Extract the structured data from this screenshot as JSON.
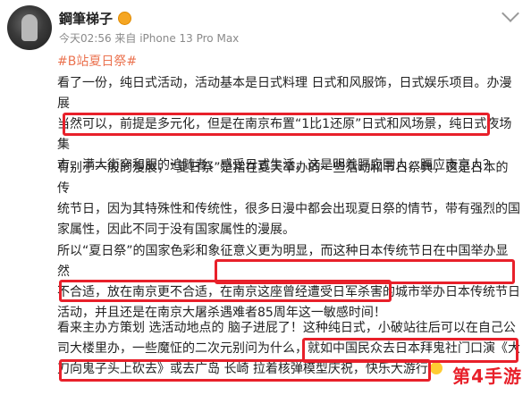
{
  "post": {
    "author": "鋼筆梯子",
    "meta": "今天02:56  来自 iPhone 13 Pro Max",
    "hashtag": "#B站夏日祭#",
    "paragraphs": [
      "看了一份，纯日式活动，活动基本是日式料理 日式和风服饰，日式娱乐项目。办漫展\n当然可以，前提是多元化，但是在南京布置“1比1还原”日式和风场景，纯日式夜场集\n市，满大街穿和服的追随者，感受日式生活，这是明着膈应国人，膈应南京人？",
      "有别于一般的漫展，“夏日祭”是指在夏天举办的一些活动和节日祭典，这是日本的传\n统节日，因为其特殊性和传统性，很多日漫中都会出现夏日祭的情节，带有强烈的国\n家属性，因此不同于没有国家属性的漫展。",
      "所以“夏日祭”的国家色彩和象征意义更为明显，而这种日本传统节日在中国举办显然\n不合适，放在南京更不合适，在南京这座曾经遭受日军杀害的城市举办日本传统节日\n活动，并且还是在南京大屠杀遇难者85周年这一敏感时间！",
      "看来主办方策划 选活动地点的 脑子进屁了！这种纯日式，小破站往后可以在自己公\n司大楼里办，一些魔怔的二次元别问为什么，就如中国民众去日本拜鬼社门口演《大\n刀向鬼子头上砍去》或去广岛 长崎 拉着核弹模型庆祝，快乐大游行"
    ]
  },
  "watermark": "第4手游",
  "icons": [
    "avatar",
    "verified-badge-icon",
    "chevron-down-icon",
    "emoji-icon"
  ],
  "colors": {
    "highlight_box": "#e8202a",
    "hashtag": "#eb7350",
    "meta": "#8a8a8a"
  }
}
